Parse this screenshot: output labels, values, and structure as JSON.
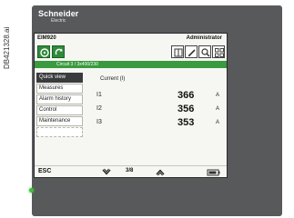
{
  "doc_id": "DB421328.ai",
  "brand": {
    "name": "Schneider",
    "sub": "Electric"
  },
  "screen": {
    "device_name": "EIM920",
    "mode": "Administrator",
    "breadcrumb": "Circuit 3 / 3x400/230",
    "menu": [
      {
        "label": "Quick view",
        "selected": true
      },
      {
        "label": "Measures",
        "selected": false
      },
      {
        "label": "Alarm history",
        "selected": false
      },
      {
        "label": "Control",
        "selected": false
      },
      {
        "label": "Maintenance",
        "selected": false
      },
      {
        "label": "",
        "selected": false
      }
    ],
    "content": {
      "title": "Current (I)",
      "rows": [
        {
          "label": "I1",
          "value": "366",
          "unit": "A"
        },
        {
          "label": "I2",
          "value": "356",
          "unit": "A"
        },
        {
          "label": "I3",
          "value": "353",
          "unit": "A"
        }
      ]
    },
    "footer": {
      "esc": "ESC",
      "page": "3/8"
    }
  },
  "icons": {
    "top_left_1": "home-icon",
    "top_left_2": "sync-icon",
    "top_right": [
      "book-icon",
      "pencil-icon",
      "search-icon",
      "network-icon"
    ],
    "footer": [
      "chevron-down-icon",
      "chevron-up-icon",
      "battery-icon"
    ]
  },
  "colors": {
    "panel": "#58595b",
    "accent_green": "#3a9a3f",
    "selected_menu": "#3a3b3d",
    "led": "#3fbf3f"
  }
}
